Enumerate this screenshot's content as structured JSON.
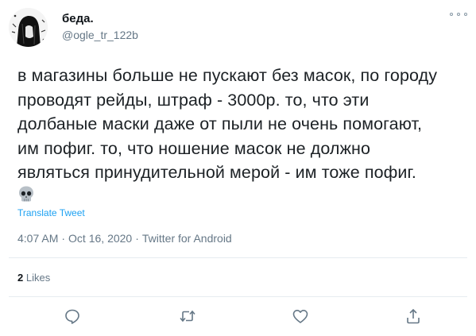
{
  "user": {
    "display_name": "беда.",
    "handle": "@ogle_tr_122b"
  },
  "tweet": {
    "lines": [
      "в магазины больше не пускают без масок, по городу",
      "проводят рейды, штраф - 3000р. то, что эти",
      "долбаные маски даже от пыли не очень помогают,",
      "им пофиг. то, что ношение масок не должно",
      "являться принудительной мерой - им тоже пофиг."
    ],
    "emoji": "skull-emoji",
    "translate_label": "Translate Tweet"
  },
  "meta": {
    "time": "4:07 AM",
    "separator": "·",
    "date": "Oct 16, 2020",
    "source": "Twitter for Android"
  },
  "engagement": {
    "likes_count": "2",
    "likes_label": "Likes"
  },
  "actions": {
    "reply_icon": "reply-icon",
    "retweet_icon": "retweet-icon",
    "like_icon": "like-icon",
    "share_icon": "share-icon"
  },
  "colors": {
    "accent": "#1da1f2",
    "secondary_text": "#657786",
    "divider": "#e6ecf0"
  }
}
